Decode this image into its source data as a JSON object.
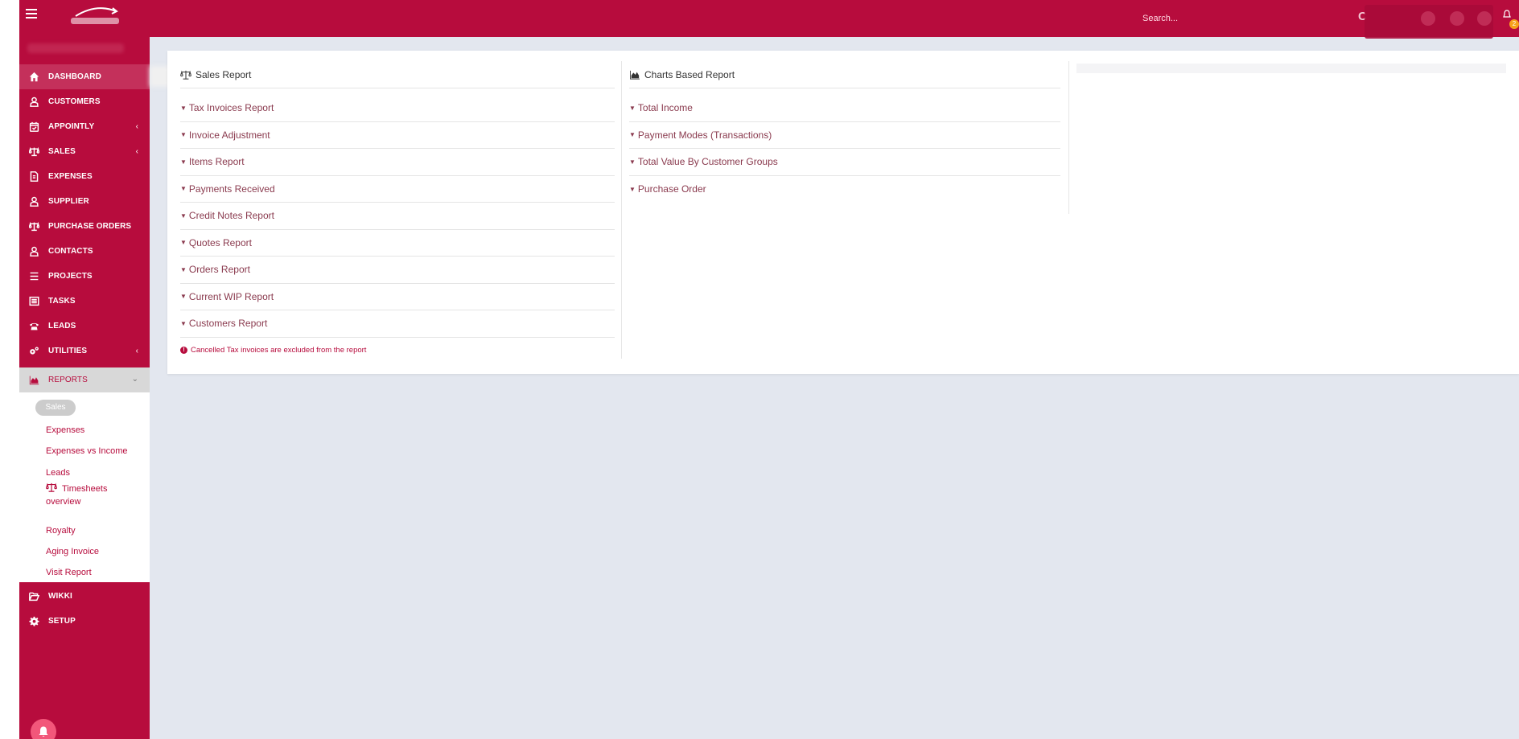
{
  "header": {
    "search_placeholder": "Search...",
    "letter": "C",
    "badge_count": "2"
  },
  "sidebar": {
    "items": [
      {
        "label": "DASHBOARD"
      },
      {
        "label": "CUSTOMERS"
      },
      {
        "label": "APPOINTLY"
      },
      {
        "label": "SALES"
      },
      {
        "label": "EXPENSES"
      },
      {
        "label": "SUPPLIER"
      },
      {
        "label": "PURCHASE ORDERS"
      },
      {
        "label": "CONTACTS"
      },
      {
        "label": "PROJECTS"
      },
      {
        "label": "TASKS"
      },
      {
        "label": "LEADS"
      },
      {
        "label": "UTILITIES"
      },
      {
        "label": "REPORTS"
      },
      {
        "label": "WIKKI"
      },
      {
        "label": "SETUP"
      }
    ],
    "reports_submenu": {
      "active": "Sales",
      "links": [
        "Expenses",
        "Expenses vs Income",
        "Leads",
        "Timesheets overview",
        "Royalty",
        "Aging Invoice",
        "Visit Report"
      ]
    }
  },
  "main": {
    "sales_report": {
      "title": "Sales Report",
      "links": [
        "Tax Invoices Report",
        "Invoice Adjustment",
        "Items Report",
        "Payments Received",
        "Credit Notes Report",
        "Quotes Report",
        "Orders Report",
        "Current WIP Report",
        "Customers Report"
      ],
      "note": "Cancelled Tax invoices are excluded from the report"
    },
    "charts_report": {
      "title": "Charts Based Report",
      "links": [
        "Total Income",
        "Payment Modes (Transactions)",
        "Total Value By Customer Groups",
        "Purchase Order"
      ]
    }
  },
  "colors": {
    "brand": "#b70c3d",
    "background": "#e3e7ef",
    "link": "#8a3a4e"
  }
}
